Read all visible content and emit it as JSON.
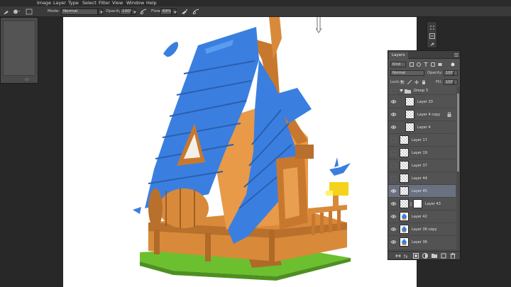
{
  "menu": [
    "Image",
    "Layer",
    "Type",
    "Select",
    "Filter",
    "View",
    "Window",
    "Help"
  ],
  "options_bar": {
    "mode_label": "Mode:",
    "mode_value": "Normal",
    "opacity_label": "Opacity:",
    "opacity_value": "100%",
    "flow_label": "Flow:",
    "flow_value": "69%"
  },
  "layers_panel": {
    "tab_label": "Layers",
    "kind_value": "Kind",
    "blend_mode": "Normal",
    "opacity_label": "Opacity:",
    "opacity_value": "100%",
    "lock_label": "Lock:",
    "fill_label": "Fill:",
    "fill_value": "100%",
    "group_name": "Group 3",
    "layers": [
      {
        "name": "Layer 20",
        "visible": true,
        "selected": false
      },
      {
        "name": "Layer 4 copy",
        "visible": true,
        "selected": false
      },
      {
        "name": "Layer 4",
        "visible": true,
        "selected": false
      },
      {
        "name": "Layer 17",
        "visible": false,
        "selected": false
      },
      {
        "name": "Layer 19",
        "visible": false,
        "selected": false
      },
      {
        "name": "Layer 37",
        "visible": false,
        "selected": false
      },
      {
        "name": "Layer 44",
        "visible": false,
        "selected": false
      },
      {
        "name": "Layer 45",
        "visible": true,
        "selected": true
      },
      {
        "name": "Layer 43",
        "visible": true,
        "selected": false
      },
      {
        "name": "Layer 42",
        "visible": true,
        "selected": false
      },
      {
        "name": "Layer 36 copy",
        "visible": true,
        "selected": false
      },
      {
        "name": "Layer 36",
        "visible": true,
        "selected": false
      }
    ]
  },
  "colors": {
    "roof_blue": "#3a7fe0",
    "wood": "#d88a3a",
    "grass": "#6cbf2e",
    "accent_yellow": "#f5d21c",
    "selected_row": "#6a7180"
  }
}
